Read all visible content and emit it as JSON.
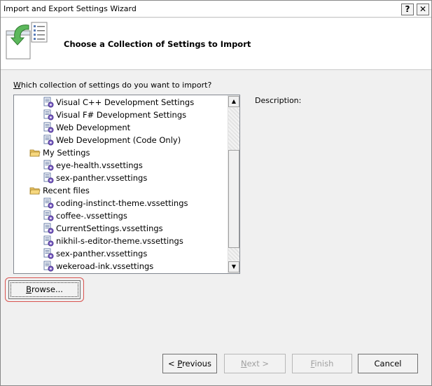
{
  "window": {
    "title": "Import and Export Settings Wizard",
    "help_glyph": "?",
    "close_glyph": "✕"
  },
  "header": {
    "title": "Choose a Collection of Settings to Import"
  },
  "question": {
    "mnemonic": "W",
    "rest": "hich collection of settings do you want to import?"
  },
  "tree": {
    "items": [
      {
        "label": "Visual C++ Development Settings",
        "kind": "settings"
      },
      {
        "label": "Visual F# Development Settings",
        "kind": "settings"
      },
      {
        "label": "Web Development",
        "kind": "settings"
      },
      {
        "label": "Web Development (Code Only)",
        "kind": "settings"
      },
      {
        "label": "My Settings",
        "kind": "folder"
      },
      {
        "label": "eye-health.vssettings",
        "kind": "settings"
      },
      {
        "label": "sex-panther.vssettings",
        "kind": "settings"
      },
      {
        "label": "Recent files",
        "kind": "folder"
      },
      {
        "label": "coding-instinct-theme.vssettings",
        "kind": "settings"
      },
      {
        "label": "coffee-.vssettings",
        "kind": "settings"
      },
      {
        "label": "CurrentSettings.vssettings",
        "kind": "settings"
      },
      {
        "label": "nikhil-s-editor-theme.vssettings",
        "kind": "settings"
      },
      {
        "label": "sex-panther.vssettings",
        "kind": "settings"
      },
      {
        "label": "wekeroad-ink.vssettings",
        "kind": "settings"
      }
    ]
  },
  "description": {
    "label": "Description:"
  },
  "buttons": {
    "browse_mnemonic": "B",
    "browse_rest": "rowse...",
    "previous_prefix": "< ",
    "previous_mnemonic": "P",
    "previous_rest": "revious",
    "next_mnemonic": "N",
    "next_rest": "ext >",
    "finish_mnemonic": "F",
    "finish_rest": "inish",
    "cancel": "Cancel"
  },
  "colors": {
    "highlight_ring": "#d9534f",
    "disabled_text": "#a0a0a0"
  }
}
